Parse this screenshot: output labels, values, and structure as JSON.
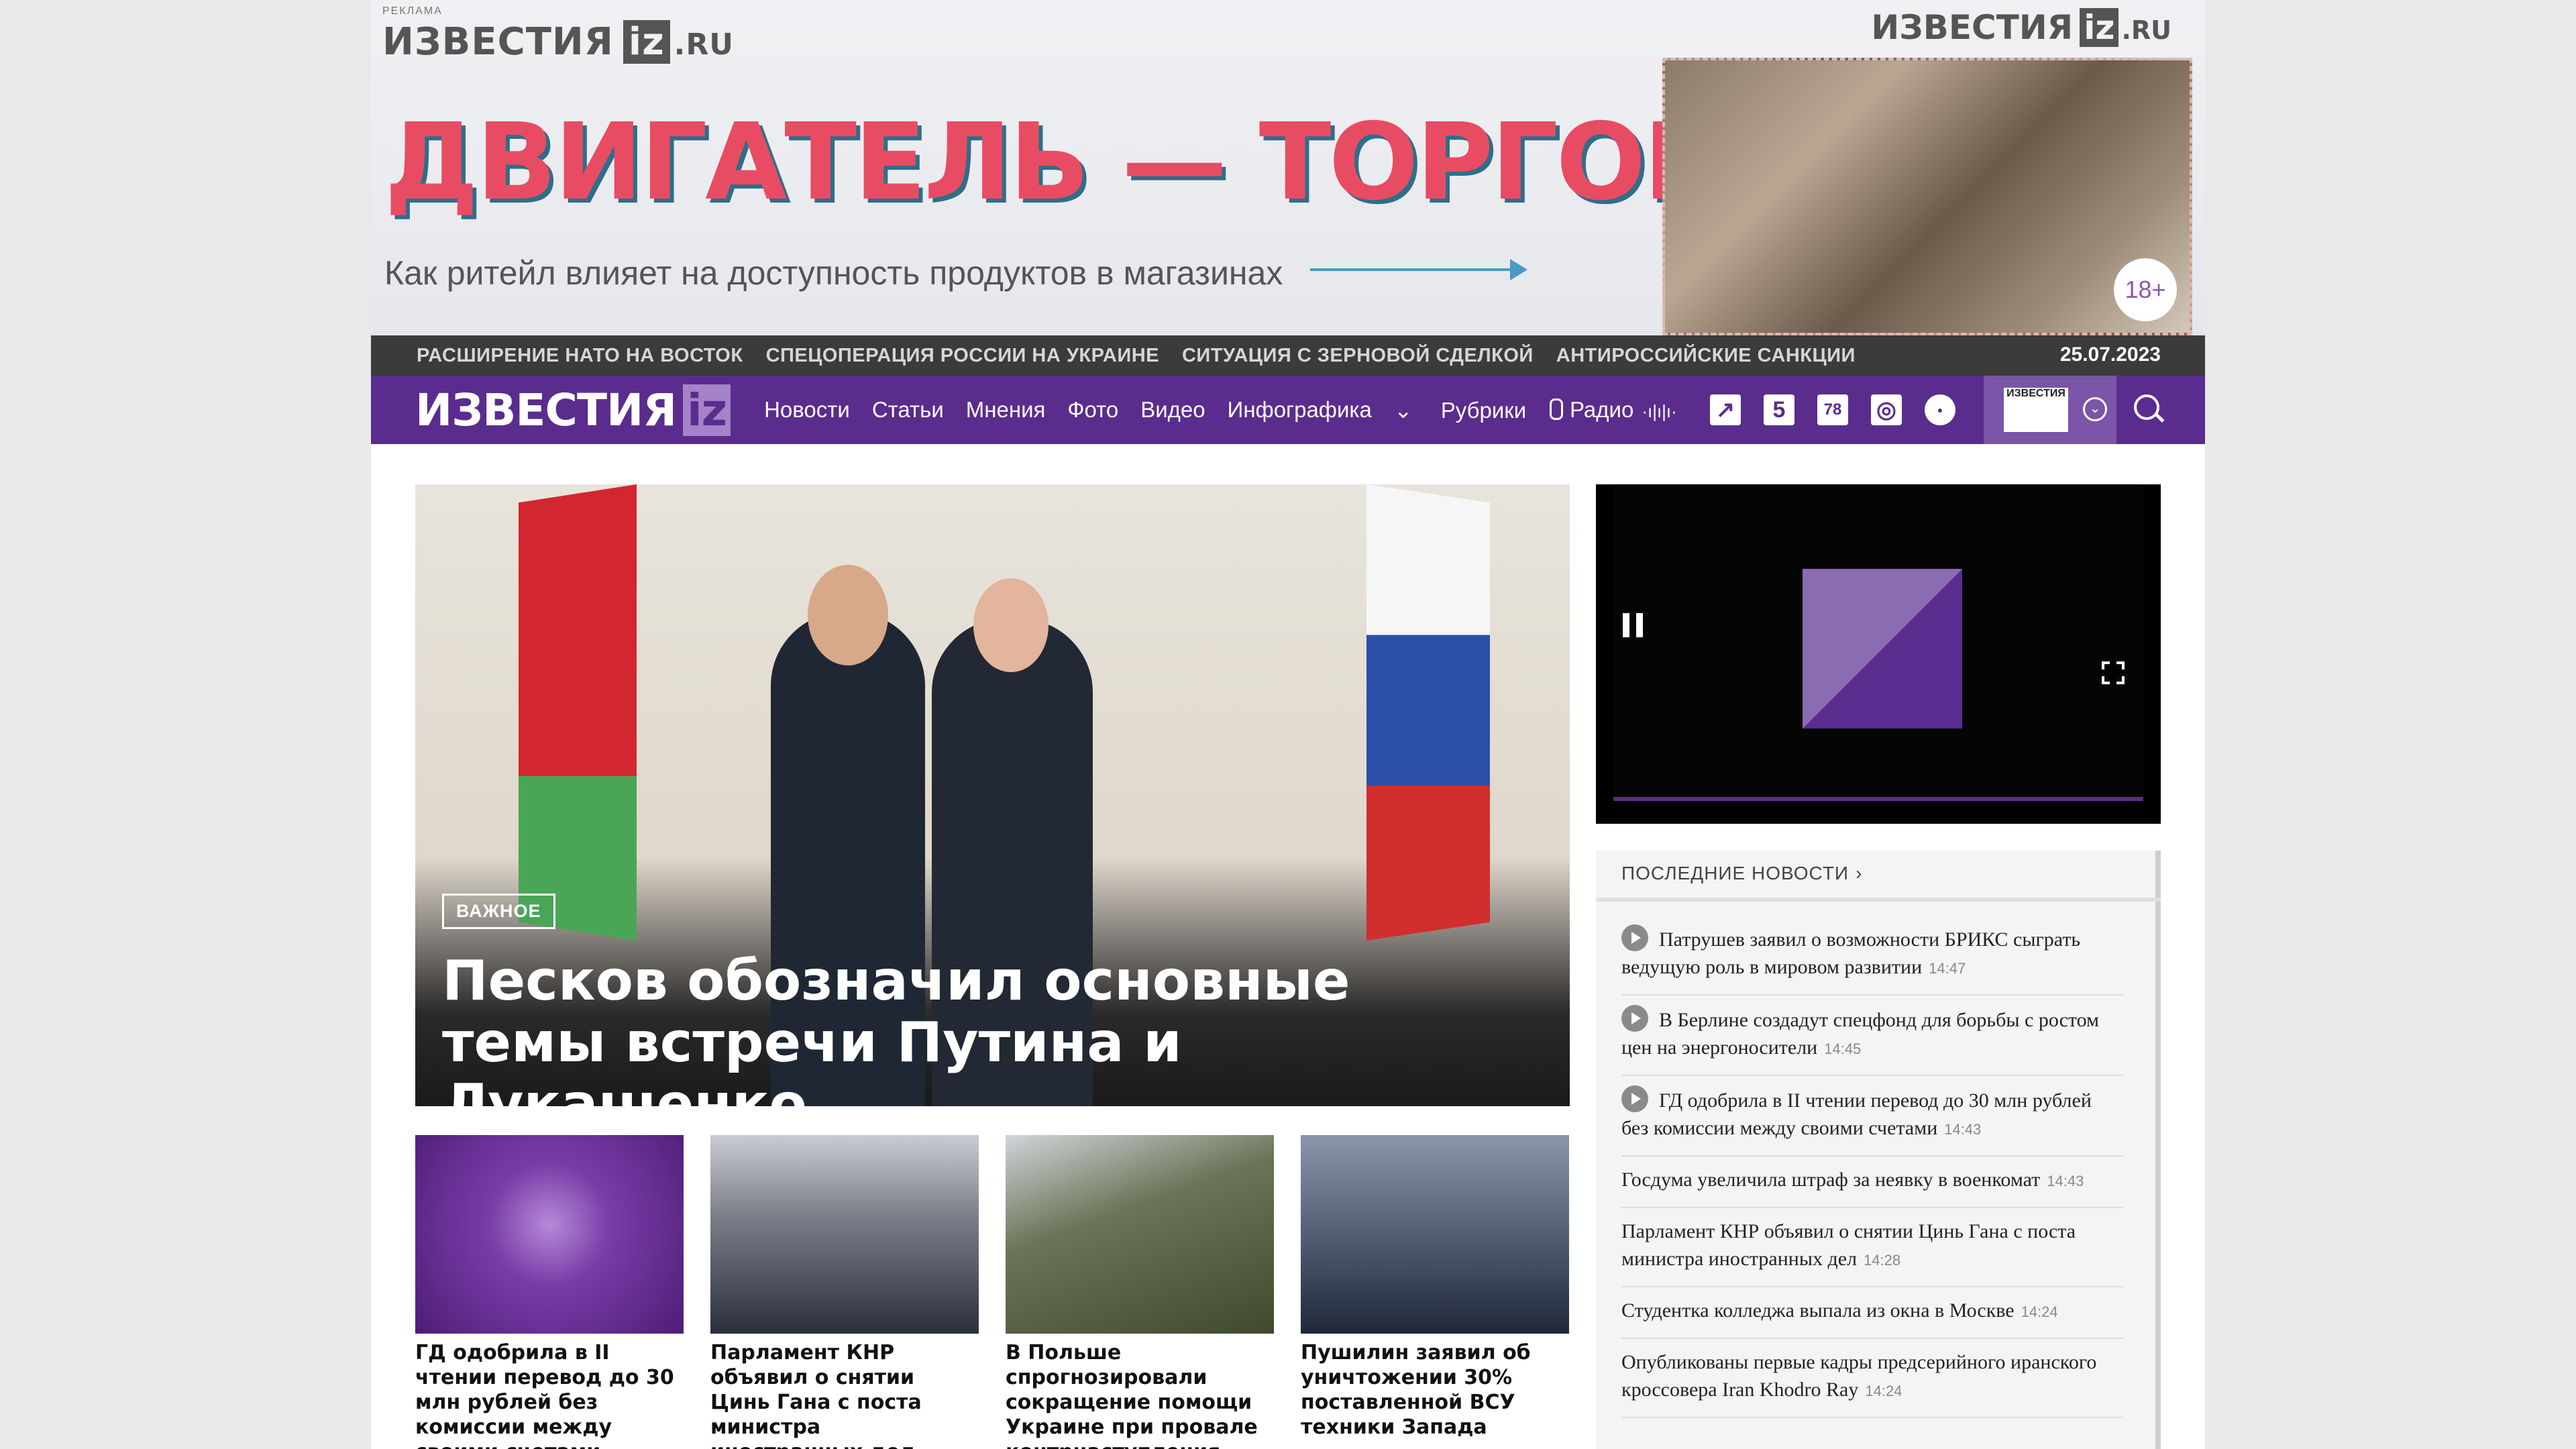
{
  "banner": {
    "ad_label": "РЕКЛАМА",
    "logo_text": "ИЗВЕСТИЯ",
    "logo_iz": "iz",
    "logo_ru": ".RU",
    "headline": "ДВИГАТЕЛЬ — ТОРГОВЛЯ",
    "subheadline": "Как ритейл влияет на доступность продуктов в магазинах",
    "age_rating": "18+"
  },
  "trending": {
    "items": [
      "РАСШИРЕНИЕ НАТО НА ВОСТОК",
      "СПЕЦОПЕРАЦИЯ РОССИИ НА УКРАИНЕ",
      "СИТУАЦИЯ С ЗЕРНОВОЙ СДЕЛКОЙ",
      "АНТИРОССИЙСКИЕ САНКЦИИ"
    ],
    "date": "25.07.2023"
  },
  "nav": {
    "brand": "ИЗВЕСТИЯ",
    "brand_iz": "iz",
    "menu": [
      "Новости",
      "Статьи",
      "Мнения",
      "Фото",
      "Видео",
      "Инфографика",
      "Рубрики"
    ],
    "radio_label": "Радио",
    "radio_wave": "·ı|ı|ı·",
    "channel_icons": [
      "5",
      "78"
    ],
    "newspaper_label": "ИЗВЕСТИЯ"
  },
  "hero": {
    "badge": "ВАЖНОЕ",
    "title": "Песков обозначил основные темы встречи Путина и Лукашенко"
  },
  "latest": {
    "header": "ПОСЛЕДНИЕ НОВОСТИ",
    "items": [
      {
        "text": "Патрушев заявил о возможности БРИКС сыграть ведущую роль в мировом развитии",
        "time": "14:47",
        "video": true
      },
      {
        "text": "В Берлине создадут спецфонд для борьбы с ростом цен на энергоносители",
        "time": "14:45",
        "video": true
      },
      {
        "text": "ГД одобрила в II чтении перевод до 30 млн рублей без комиссии между своими счетами",
        "time": "14:43",
        "video": true
      },
      {
        "text": "Госдума увеличила штраф за неявку в военкомат",
        "time": "14:43",
        "video": false
      },
      {
        "text": "Парламент КНР объявил о снятии Цинь Гана с поста министра иностранных дел",
        "time": "14:28",
        "video": false
      },
      {
        "text": "Студентка колледжа выпала из окна в Москве",
        "time": "14:24",
        "video": false
      },
      {
        "text": "Опубликованы первые кадры предсерийного иранского кроссовера Iran Khodro Ray",
        "time": "14:24",
        "video": false
      }
    ]
  },
  "cards": [
    {
      "title": "ГД одобрила в II чтении перевод до 30 млн рублей без комиссии между своими счетами"
    },
    {
      "title": "Парламент КНР объявил о снятии Цинь Гана с поста министра иностранных дел"
    },
    {
      "title": "В Польше спрогнозировали сокращение помощи Украине при провале контрнаступления"
    },
    {
      "title": "Пушилин заявил об уничтожении 30% поставленной ВСУ техники Запада"
    }
  ],
  "colors": {
    "brand_purple": "#5a2c8e",
    "trending_bg": "#3b3b3b",
    "banner_red": "#e84c63"
  }
}
